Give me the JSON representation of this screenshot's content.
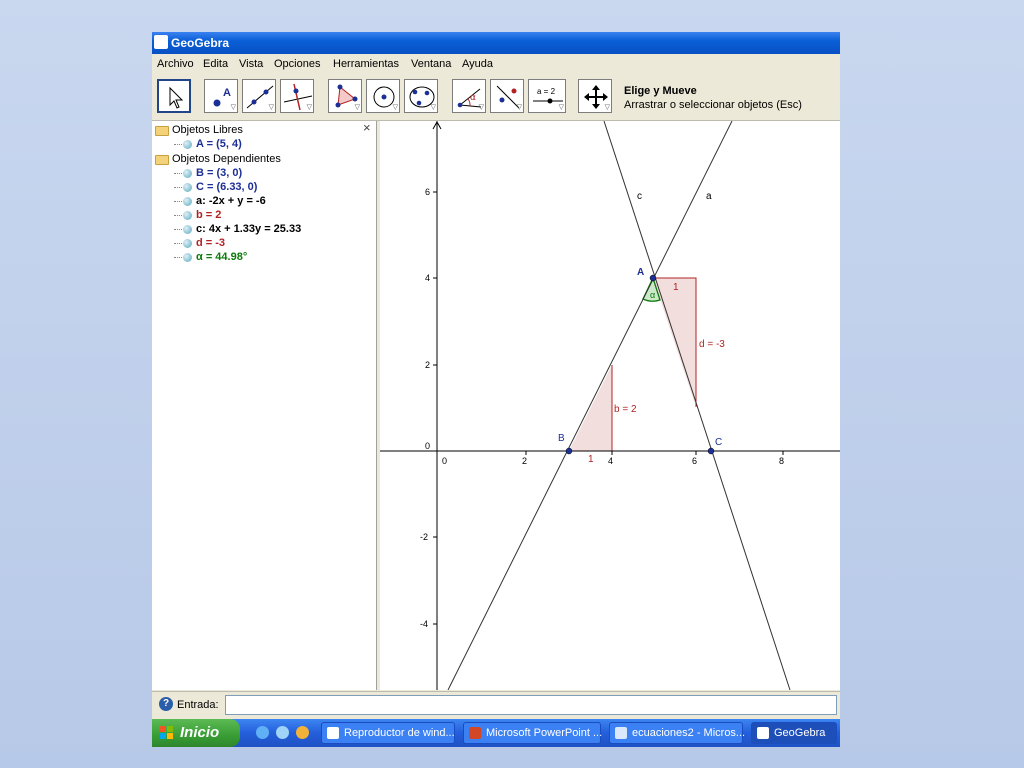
{
  "window": {
    "title": "GeoGebra"
  },
  "menu": [
    "Archivo",
    "Edita",
    "Vista",
    "Opciones",
    "Herramientas",
    "Ventana",
    "Ayuda"
  ],
  "toolbar": {
    "tool_name": "Elige y Mueve",
    "tool_help": "Arrastrar o seleccionar objetos (Esc)",
    "slider_label": "a = 2",
    "point_label": "A",
    "angle_label": "α"
  },
  "algebra": {
    "close_glyph": "×",
    "free_header": "Objetos Libres",
    "dependent_header": "Objetos Dependientes",
    "free": [
      {
        "text": "A = (5, 4)",
        "color": "#1c2f96"
      }
    ],
    "dependent": [
      {
        "text": "B = (3, 0)",
        "color": "#1c2f96"
      },
      {
        "text": "C = (6.33, 0)",
        "color": "#1c2f96"
      },
      {
        "text": "a: -2x + y = -6",
        "color": "#000000"
      },
      {
        "text": "b = 2",
        "color": "#b22222"
      },
      {
        "text": "c: 4x + 1.33y = 25.33",
        "color": "#000000"
      },
      {
        "text": "d = -3",
        "color": "#b22222"
      },
      {
        "text": "α = 44.98°",
        "color": "#0a7a0a"
      }
    ]
  },
  "graph": {
    "x_ticks": [
      "0",
      "2",
      "4",
      "6",
      "8"
    ],
    "y_ticks": [
      "6",
      "4",
      "2",
      "0",
      "-2",
      "-4"
    ],
    "line_labels": {
      "a": "a",
      "c": "c"
    },
    "point_labels": {
      "A": "A",
      "B": "B",
      "C": "C"
    },
    "slope_labels": {
      "b_run": "1",
      "b_rise": "b = 2",
      "d_run": "1",
      "d_rise": "d = -3"
    },
    "angle_label": "α",
    "colors": {
      "line": "#333333",
      "point": "#1c2f96",
      "slope": "#b22222",
      "slope_fill": "#f3dede",
      "angle": "#0a7a0a",
      "angle_fill": "#cde8c8"
    }
  },
  "input": {
    "label": "Entrada:",
    "help_glyph": "?",
    "value": "",
    "placeholder": ""
  },
  "taskbar": {
    "start_label": "Inicio",
    "tasks": [
      "Reproductor de wind...",
      "Microsoft PowerPoint ...",
      "ecuaciones2 - Micros...",
      "GeoGebra"
    ],
    "active_task": "GeoGebra"
  }
}
